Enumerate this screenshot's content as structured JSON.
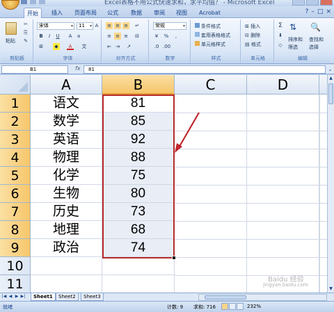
{
  "window": {
    "title": "Excel表格不用公式快速求和，求平均值？ - Microsoft Excel"
  },
  "ribbon_tabs": [
    "开始",
    "插入",
    "页面布局",
    "公式",
    "数据",
    "审阅",
    "视图",
    "Acrobat"
  ],
  "ribbon": {
    "clipboard": {
      "label": "剪贴板",
      "paste": "粘贴"
    },
    "font": {
      "label": "字体",
      "font_name": "宋体",
      "font_size": "11"
    },
    "alignment": {
      "label": "对齐方式"
    },
    "number": {
      "label": "数字",
      "format": "常规"
    },
    "styles": {
      "label": "样式",
      "conditional": "条件格式",
      "table_format": "套用表格格式",
      "cell_style": "单元格样式"
    },
    "cells": {
      "label": "单元格",
      "insert": "插入",
      "delete": "删除",
      "format": "格式"
    },
    "editing": {
      "label": "编辑",
      "sort": "排序和",
      "sort2": "筛选",
      "find": "查找和",
      "find2": "选择"
    }
  },
  "formula_bar": {
    "name_box": "B1",
    "fx": "fx",
    "value": "81"
  },
  "grid": {
    "columns": [
      "A",
      "B",
      "C",
      "D"
    ],
    "rows": [
      "1",
      "2",
      "3",
      "4",
      "5",
      "6",
      "7",
      "8",
      "9",
      "10",
      "11"
    ],
    "subjects": [
      "语文",
      "数学",
      "英语",
      "物理",
      "化学",
      "生物",
      "历史",
      "地理",
      "政治"
    ],
    "scores": [
      "81",
      "85",
      "92",
      "88",
      "75",
      "80",
      "73",
      "68",
      "74"
    ]
  },
  "sheets": [
    "Sheet1",
    "Sheet2",
    "Sheet3"
  ],
  "status": {
    "ready": "就绪",
    "count": "计数: 9",
    "sum": "求和: 716",
    "zoom": "232%"
  },
  "watermark": {
    "line1": "Baidu 经验",
    "line2": "jingyan.baidu.com"
  },
  "colors": {
    "selection_border": "#b92a2a",
    "arrow": "#c0262d",
    "header_selected": "#f6c66b",
    "ribbon_bg": "#dce8f7"
  }
}
